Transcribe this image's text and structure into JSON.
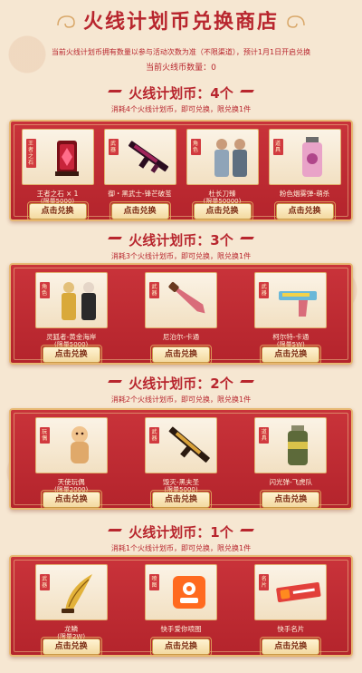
{
  "header": {
    "title": "火线计划币兑换商店",
    "notice": "当前火线计划币拥有数量以参与活动次数为准（不限渠道），预计1月1日开启兑换",
    "count_label": "当前火线币数量：",
    "count_value": "0"
  },
  "colors": {
    "red": "#b8262e",
    "gold": "#e7b873",
    "panel": "#c9333a"
  },
  "button_label": "点击兑换",
  "sections": [
    {
      "title": "火线计划币：4个",
      "subtitle": "消耗4个火线计划币，即可兑换，限兑换1件",
      "items": [
        {
          "tag": "王者之石",
          "name": "王者之石 × 1",
          "limit": "(限量5000)",
          "icon": "stone-icon"
        },
        {
          "tag": "武器",
          "name": "御・黑武士-锋芒破茧",
          "limit": "",
          "icon": "rifle-icon"
        },
        {
          "tag": "角色",
          "name": "杜长刀臻",
          "limit": "(限量50000)",
          "icon": "character-icon"
        },
        {
          "tag": "道具",
          "name": "粉色烟雾弹-萌杀",
          "limit": "",
          "icon": "grenade-icon"
        }
      ]
    },
    {
      "title": "火线计划币：3个",
      "subtitle": "消耗3个火线计划币，即可兑换，限兑换1件",
      "items": [
        {
          "tag": "角色",
          "name": "灵狐者-黄金海岸",
          "limit": "(限量5000)",
          "icon": "character-icon"
        },
        {
          "tag": "武器",
          "name": "尼泊尔-卡通",
          "limit": "",
          "icon": "knife-icon"
        },
        {
          "tag": "武器",
          "name": "柯尔特-卡通",
          "limit": "(限量5W)",
          "icon": "pistol-icon"
        }
      ]
    },
    {
      "title": "火线计划币：2个",
      "subtitle": "消耗2个火线计划币，即可兑换，限兑换1件",
      "items": [
        {
          "tag": "玩偶",
          "name": "天使玩偶",
          "limit": "(限量2000)",
          "icon": "doll-icon"
        },
        {
          "tag": "武器",
          "name": "毁灭-黑夫圣",
          "limit": "(限量5000)",
          "icon": "rifle-icon"
        },
        {
          "tag": "道具",
          "name": "闪光弹-飞虎队",
          "limit": "",
          "icon": "grenade-icon"
        }
      ]
    },
    {
      "title": "火线计划币：1个",
      "subtitle": "消耗1个火线计划币，即可兑换，限兑换1件",
      "items": [
        {
          "tag": "武器",
          "name": "龙鳞",
          "limit": "(限量2W)",
          "icon": "dagger-icon"
        },
        {
          "tag": "喷图",
          "name": "快手爱你喷图",
          "limit": "",
          "icon": "spray-icon"
        },
        {
          "tag": "名片",
          "name": "快手名片",
          "limit": "",
          "icon": "card-icon"
        }
      ]
    }
  ]
}
